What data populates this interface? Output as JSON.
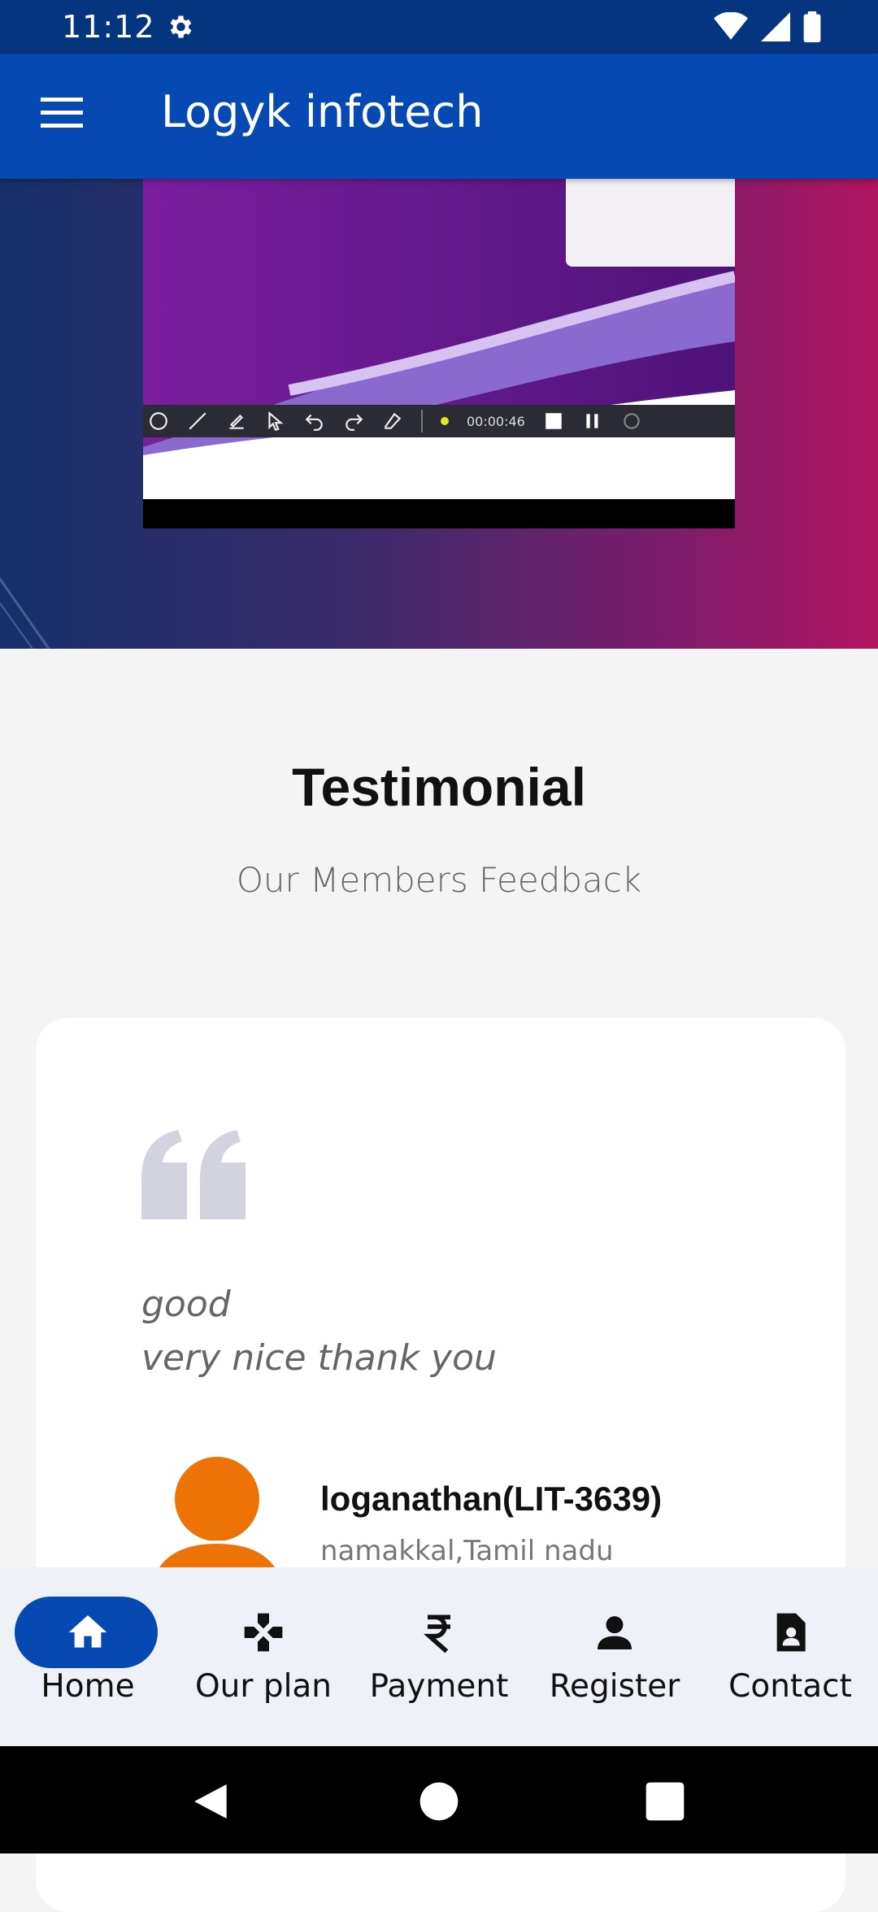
{
  "status_bar": {
    "time": "11:12",
    "icons": [
      "settings-gear-icon",
      "wifi-icon",
      "cell-signal-icon",
      "battery-icon"
    ]
  },
  "app_bar": {
    "title": "Logyk infotech",
    "menu_icon": "hamburger-menu-icon",
    "background": "#0649b3"
  },
  "hero": {
    "video_timer": "00:00:46"
  },
  "testimonial": {
    "title": "Testimonial",
    "subtitle": "Our Members Feedback",
    "feedback_line1": "good",
    "feedback_line2": "very nice thank you",
    "member_name": "loganathan(LIT-3639)",
    "member_location": "namakkal,Tamil nadu",
    "avatar_color": "#ee7306"
  },
  "bottom_nav": {
    "items": [
      {
        "label": "Home",
        "icon": "home-icon",
        "active": true
      },
      {
        "label": "Our plan",
        "icon": "gamepad-icon",
        "active": false
      },
      {
        "label": "Payment",
        "icon": "rupee-icon",
        "active": false
      },
      {
        "label": "Register",
        "icon": "person-icon",
        "active": false
      },
      {
        "label": "Contact",
        "icon": "contact-card-icon",
        "active": false
      }
    ]
  },
  "system_nav": [
    "back-icon",
    "home-circle-icon",
    "recents-icon"
  ]
}
